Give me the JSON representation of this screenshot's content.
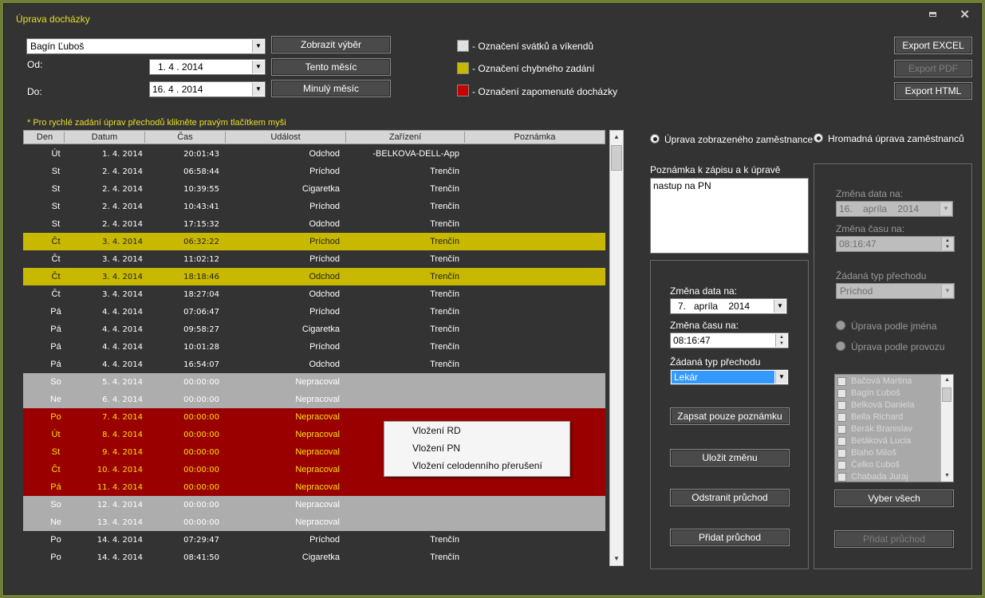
{
  "window": {
    "title": "Úprava docházky"
  },
  "filters": {
    "employee": "Bagín Ľuboš",
    "from_label": "Od:",
    "from_value": "1. 4 . 2014",
    "to_label": "Do:",
    "to_value": "16. 4 . 2014",
    "show_button": "Zobrazit výběr",
    "this_month_button": "Tento měsíc",
    "last_month_button": "Minulý měsíc"
  },
  "legend": {
    "holiday": {
      "label": "- Označení svátků a víkendů",
      "color": "#e0e0e0"
    },
    "error": {
      "label": "- Označení chybného zadání",
      "color": "#c8b900"
    },
    "forgotten": {
      "label": "- Označení zapomenuté docházky",
      "color": "#c80000"
    }
  },
  "export": {
    "excel": "Export EXCEL",
    "pdf": "Export PDF",
    "html": "Export HTML"
  },
  "hint": "* Pro rychlé zadání úprav přechodů klikněte pravým tlačítkem myši",
  "grid": {
    "columns": [
      "Den",
      "Datum",
      "Čas",
      "Událost",
      "Zařízení",
      "Poznámka"
    ],
    "rows": [
      {
        "den": "Út",
        "datum": "1. 4. 2014",
        "cas": "20:01:43",
        "udalost": "Odchod",
        "zarizeni": "-BELKOVA-DELL-App",
        "style": "normal"
      },
      {
        "den": "St",
        "datum": "2. 4. 2014",
        "cas": "06:58:44",
        "udalost": "Príchod",
        "zarizeni": "Trenčín",
        "style": "normal"
      },
      {
        "den": "St",
        "datum": "2. 4. 2014",
        "cas": "10:39:55",
        "udalost": "Cigaretka",
        "zarizeni": "Trenčín",
        "style": "normal"
      },
      {
        "den": "St",
        "datum": "2. 4. 2014",
        "cas": "10:43:41",
        "udalost": "Príchod",
        "zarizeni": "Trenčín",
        "style": "normal"
      },
      {
        "den": "St",
        "datum": "2. 4. 2014",
        "cas": "17:15:32",
        "udalost": "Odchod",
        "zarizeni": "Trenčín",
        "style": "normal"
      },
      {
        "den": "Čt",
        "datum": "3. 4. 2014",
        "cas": "06:32:22",
        "udalost": "Príchod",
        "zarizeni": "Trenčín",
        "style": "yellow"
      },
      {
        "den": "Čt",
        "datum": "3. 4. 2014",
        "cas": "11:02:12",
        "udalost": "Príchod",
        "zarizeni": "Trenčín",
        "style": "normal"
      },
      {
        "den": "Čt",
        "datum": "3. 4. 2014",
        "cas": "18:18:46",
        "udalost": "Odchod",
        "zarizeni": "Trenčín",
        "style": "yellow"
      },
      {
        "den": "Čt",
        "datum": "3. 4. 2014",
        "cas": "18:27:04",
        "udalost": "Odchod",
        "zarizeni": "Trenčín",
        "style": "normal"
      },
      {
        "den": "Pá",
        "datum": "4. 4. 2014",
        "cas": "07:06:47",
        "udalost": "Príchod",
        "zarizeni": "Trenčín",
        "style": "normal"
      },
      {
        "den": "Pá",
        "datum": "4. 4. 2014",
        "cas": "09:58:27",
        "udalost": "Cigaretka",
        "zarizeni": "Trenčín",
        "style": "normal"
      },
      {
        "den": "Pá",
        "datum": "4. 4. 2014",
        "cas": "10:01:28",
        "udalost": "Príchod",
        "zarizeni": "Trenčín",
        "style": "normal"
      },
      {
        "den": "Pá",
        "datum": "4. 4. 2014",
        "cas": "16:54:07",
        "udalost": "Odchod",
        "zarizeni": "Trenčín",
        "style": "normal"
      },
      {
        "den": "So",
        "datum": "5. 4. 2014",
        "cas": "00:00:00",
        "udalost": "Nepracoval",
        "zarizeni": "",
        "style": "gray"
      },
      {
        "den": "Ne",
        "datum": "6. 4. 2014",
        "cas": "00:00:00",
        "udalost": "Nepracoval",
        "zarizeni": "",
        "style": "gray"
      },
      {
        "den": "Po",
        "datum": "7. 4. 2014",
        "cas": "00:00:00",
        "udalost": "Nepracoval",
        "zarizeni": "",
        "style": "red"
      },
      {
        "den": "Út",
        "datum": "8. 4. 2014",
        "cas": "00:00:00",
        "udalost": "Nepracoval",
        "zarizeni": "",
        "style": "red"
      },
      {
        "den": "St",
        "datum": "9. 4. 2014",
        "cas": "00:00:00",
        "udalost": "Nepracoval",
        "zarizeni": "",
        "style": "red"
      },
      {
        "den": "Čt",
        "datum": "10. 4. 2014",
        "cas": "00:00:00",
        "udalost": "Nepracoval",
        "zarizeni": "",
        "style": "red"
      },
      {
        "den": "Pá",
        "datum": "11. 4. 2014",
        "cas": "00:00:00",
        "udalost": "Nepracoval",
        "zarizeni": "",
        "style": "red"
      },
      {
        "den": "So",
        "datum": "12. 4. 2014",
        "cas": "00:00:00",
        "udalost": "Nepracoval",
        "zarizeni": "",
        "style": "gray"
      },
      {
        "den": "Ne",
        "datum": "13. 4. 2014",
        "cas": "00:00:00",
        "udalost": "Nepracoval",
        "zarizeni": "",
        "style": "gray"
      },
      {
        "den": "Po",
        "datum": "14. 4. 2014",
        "cas": "07:29:47",
        "udalost": "Príchod",
        "zarizeni": "Trenčín",
        "style": "normal"
      },
      {
        "den": "Po",
        "datum": "14. 4. 2014",
        "cas": "08:41:50",
        "udalost": "Cigaretka",
        "zarizeni": "Trenčín",
        "style": "normal"
      }
    ]
  },
  "context_menu": [
    "Vložení RD",
    "Vložení PN",
    "Vložení celodenního přerušení"
  ],
  "mode": {
    "single": "Úprava zobrazeného zaměstnance",
    "bulk": "Hromadná úprava zaměstnanců"
  },
  "single_panel": {
    "note_label": "Poznámka k zápisu a k úpravě",
    "note_value": "nastup na PN",
    "date_label": "Změna data na:",
    "date_value": "7.   apríla    2014",
    "time_label": "Změna času na:",
    "time_value": "08:16:47",
    "type_label": "Žádaná typ přechodu",
    "type_value": "Lekár",
    "btn_note": "Zapsat pouze poznámku",
    "btn_save": "Uložit změnu",
    "btn_remove": "Odstranit průchod",
    "btn_add": "Přidat průchod"
  },
  "bulk_panel": {
    "date_label": "Změna data na:",
    "date_value": "16.    apríla    2014",
    "time_label": "Změna času na:",
    "time_value": "08:16:47",
    "type_label": "Žádaná typ přechodu",
    "type_value": "Príchod",
    "by_name": "Úprava podle jména",
    "by_operation": "Úprava podle provozu",
    "employees": [
      "Bačová Martina",
      "Bagín Ľuboš",
      "Belková Daniela",
      "Bella Richard",
      "Berák Branislav",
      "Betáková Lucia",
      "Blaho Miloš",
      "Čelko Ľuboš",
      "Chabada Juraj"
    ],
    "select_all": "Vyber všech",
    "btn_add": "Přidat průchod"
  }
}
